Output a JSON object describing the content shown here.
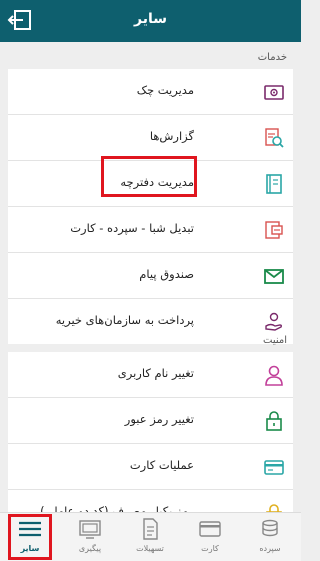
{
  "header": {
    "title": "سایر"
  },
  "sections": {
    "services_label": "خدمات",
    "security_label": "امنیت"
  },
  "services": [
    {
      "label": "مدیریت چک",
      "icon": "check-management-icon"
    },
    {
      "label": "گزارش‌ها",
      "icon": "reports-icon"
    },
    {
      "label": "مدیریت دفترچه",
      "icon": "checkbook-icon"
    },
    {
      "label": "تبدیل شبا - سپرده - کارت",
      "icon": "iban-convert-icon"
    },
    {
      "label": "صندوق پیام",
      "icon": "message-box-icon"
    },
    {
      "label": "پرداخت به سازمان‌های خیریه",
      "icon": "charity-icon"
    }
  ],
  "security": [
    {
      "label": "تغییر نام کاربری",
      "icon": "user-icon"
    },
    {
      "label": "تغییر رمز عبور",
      "icon": "lock-icon"
    },
    {
      "label": "عملیات کارت",
      "icon": "card-icon"
    },
    {
      "label": "رمز یکبار مصرف (کد دو عاملی)",
      "icon": "otp-icon"
    }
  ],
  "tabs": [
    {
      "label": "سایر",
      "icon": "menu-icon",
      "active": true
    },
    {
      "label": "پیگیری",
      "icon": "tracking-icon"
    },
    {
      "label": "تسهیلات",
      "icon": "loan-icon"
    },
    {
      "label": "کارت",
      "icon": "card-icon"
    },
    {
      "label": "سپرده",
      "icon": "deposit-icon"
    }
  ],
  "colors": {
    "header": "#0e5f6e",
    "highlight": "#e0161f",
    "accent_purple": "#7a2a6b",
    "accent_green": "#1a8a4a",
    "accent_red": "#d9534f",
    "accent_teal": "#2aa6a6"
  }
}
